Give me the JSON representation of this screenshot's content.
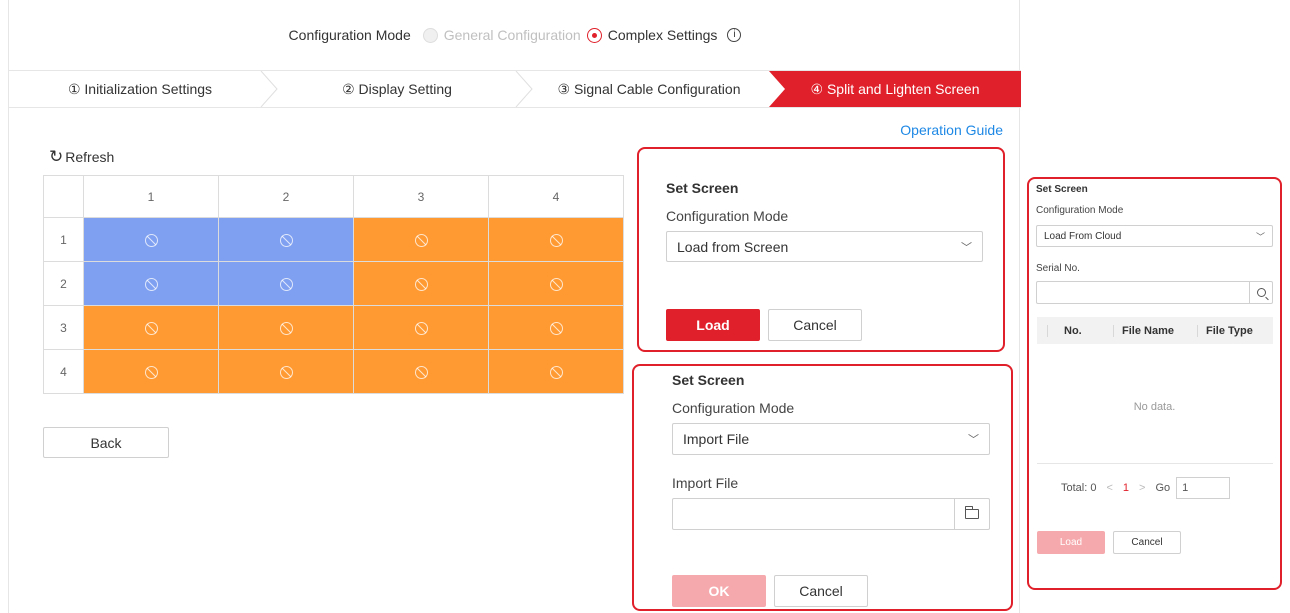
{
  "mode_bar": {
    "label": "Configuration Mode",
    "option_general": "General Configuration",
    "option_complex": "Complex Settings",
    "info_glyph": "i"
  },
  "steps": [
    {
      "label": "① Initialization Settings"
    },
    {
      "label": "② Display Setting"
    },
    {
      "label": "③ Signal Cable Configuration"
    },
    {
      "label": "④ Split and Lighten Screen"
    }
  ],
  "operation_guide": "Operation Guide",
  "refresh_label": "Refresh",
  "grid": {
    "col_headers": [
      "1",
      "2",
      "3",
      "4"
    ],
    "row_headers": [
      "1",
      "2",
      "3",
      "4"
    ],
    "cells": [
      [
        "blue",
        "blue",
        "orange",
        "orange"
      ],
      [
        "blue",
        "blue",
        "orange",
        "orange"
      ],
      [
        "orange",
        "orange",
        "orange",
        "orange"
      ],
      [
        "orange",
        "orange",
        "orange",
        "orange"
      ]
    ]
  },
  "back_label": "Back",
  "panel1": {
    "title": "Set Screen",
    "mode_label": "Configuration Mode",
    "mode_value": "Load from Screen",
    "load_label": "Load",
    "cancel_label": "Cancel"
  },
  "panel2": {
    "title": "Set Screen",
    "mode_label": "Configuration Mode",
    "mode_value": "Import File",
    "import_label": "Import File",
    "import_value": "",
    "ok_label": "OK",
    "cancel_label": "Cancel"
  },
  "panel3": {
    "title": "Set Screen",
    "mode_label": "Configuration Mode",
    "mode_value": "Load From Cloud",
    "serial_label": "Serial No.",
    "serial_value": "",
    "columns": [
      "No.",
      "File Name",
      "File Type"
    ],
    "no_data": "No data.",
    "total": "Total: 0",
    "current_page": "1",
    "go_label": "Go",
    "go_value": "1",
    "load_label": "Load",
    "cancel_label": "Cancel"
  },
  "colors": {
    "accent_red": "#e0202a",
    "cell_blue": "#7fa0f0",
    "cell_orange": "#ff9a33",
    "link_blue": "#1e88e5"
  }
}
